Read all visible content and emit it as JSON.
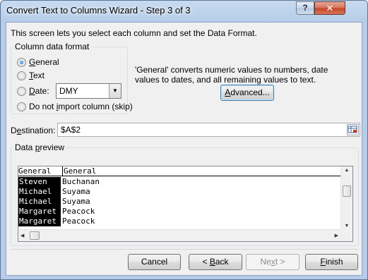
{
  "window": {
    "title": "Convert Text to Columns Wizard - Step 3 of 3",
    "help_label": "?",
    "close_label": "✕"
  },
  "intro_text": "This screen lets you select each column and set the Data Format.",
  "column_format": {
    "legend": "Column data format",
    "options": [
      {
        "label": "General",
        "checked": true
      },
      {
        "label": "Text",
        "checked": false
      },
      {
        "label": "Date:",
        "checked": false
      },
      {
        "label": "Do not import column (skip)",
        "checked": false
      }
    ],
    "date_format": "DMY"
  },
  "description": "'General' converts numeric values to numbers, date values to dates, and all remaining values to text.",
  "advanced_button": "Advanced...",
  "destination": {
    "label": "Destination:",
    "value": "$A$2"
  },
  "data_preview": {
    "legend": "Data preview",
    "headers": [
      "General",
      "General"
    ],
    "rows": [
      [
        "Steven",
        "Buchanan"
      ],
      [
        "Michael",
        "Suyama"
      ],
      [
        "Michael",
        "Suyama"
      ],
      [
        "Margaret",
        "Peacock"
      ],
      [
        "Margaret",
        "Peacock"
      ]
    ]
  },
  "buttons": {
    "cancel": "Cancel",
    "back": "< Back",
    "next": "Next >",
    "finish": "Finish"
  },
  "colors": {
    "title_bar": "#b6cce8",
    "close_button": "#c24526",
    "dialog_bg": "#f0f0f0"
  }
}
